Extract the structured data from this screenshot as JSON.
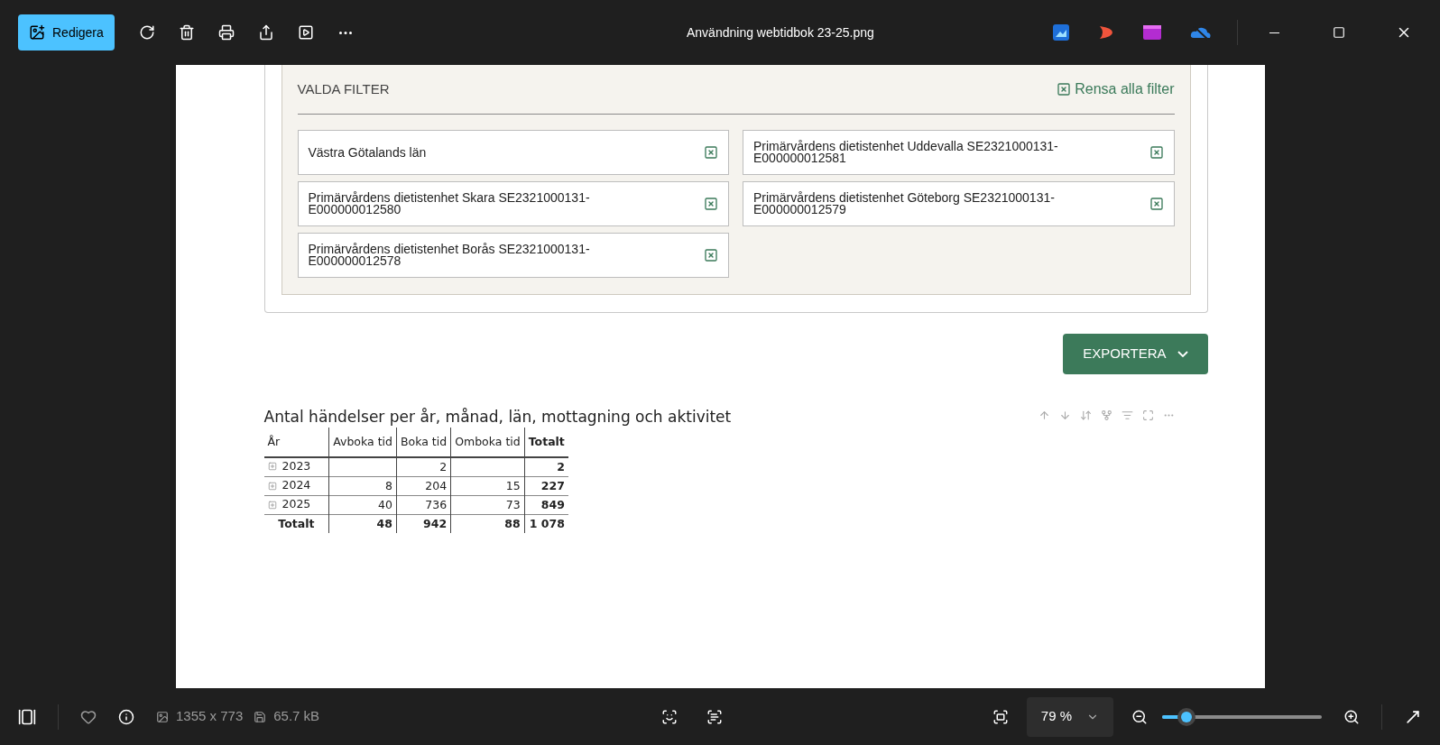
{
  "titlebar": {
    "edit_button": "Redigera",
    "title": "Användning webtidbok 23-25.png"
  },
  "filters": {
    "heading": "VALDA FILTER",
    "clear_all": "Rensa alla filter",
    "items": [
      {
        "label": "Västra Götalands län"
      },
      {
        "label": "Primärvårdens dietistenhet Uddevalla SE2321000131-E000000012581"
      },
      {
        "label": "Primärvårdens dietistenhet Skara SE2321000131-E000000012580"
      },
      {
        "label": "Primärvårdens dietistenhet Göteborg SE2321000131-E000000012579"
      },
      {
        "label": "Primärvårdens dietistenhet Borås SE2321000131-E000000012578"
      }
    ]
  },
  "export_button": "EXPORTERA",
  "table": {
    "title": "Antal händelser per år, månad, län, mottagning och aktivitet",
    "columns": [
      "År",
      "Avboka tid",
      "Boka tid",
      "Omboka tid",
      "Totalt"
    ],
    "rows": [
      {
        "kind": "group",
        "expanded": false,
        "cells": [
          "2023",
          "",
          "2",
          "",
          "2"
        ]
      },
      {
        "kind": "group",
        "expanded": false,
        "cells": [
          "2024",
          "8",
          "204",
          "15",
          "227"
        ]
      },
      {
        "kind": "group",
        "expanded": false,
        "cells": [
          "2025",
          "40",
          "736",
          "73",
          "849"
        ]
      },
      {
        "kind": "total",
        "cells": [
          "Totalt",
          "48",
          "942",
          "88",
          "1 078"
        ]
      }
    ]
  },
  "statusbar": {
    "dimensions": "1355 x 773",
    "file_size": "65.7 kB",
    "zoom": "79 %",
    "zoom_slider": {
      "level": 0.15
    }
  }
}
